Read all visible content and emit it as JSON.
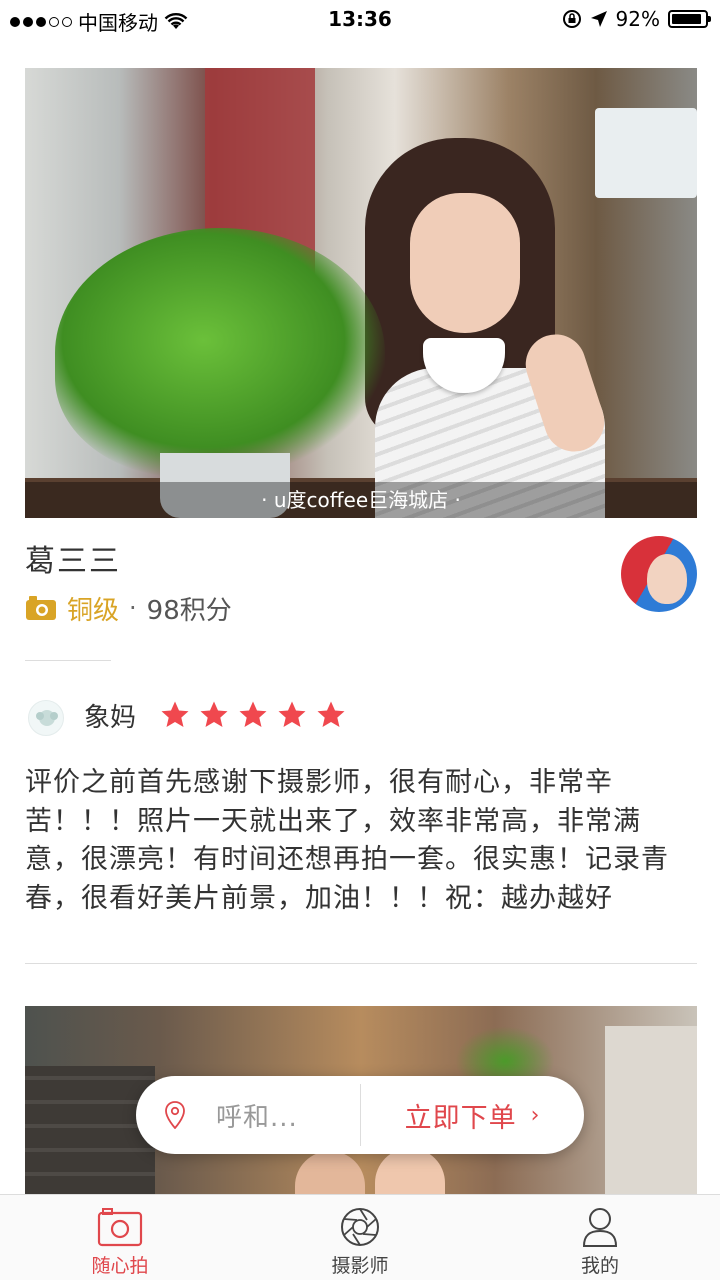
{
  "status_bar": {
    "carrier": "中国移动",
    "time": "13:36",
    "battery": "92%",
    "battery_level": 0.92,
    "signal_bars_filled": 3,
    "signal_bars_total": 5
  },
  "feed": {
    "photo_caption": "· u度coffee巨海城店 ·",
    "photographer": {
      "name": "葛三三",
      "level": "铜级",
      "separator": "·",
      "points": "98积分"
    },
    "review": {
      "reviewer": "象妈",
      "rating": 5,
      "text": "评价之前首先感谢下摄影师，很有耐心，非常辛苦！！！照片一天就出来了，效率非常高，非常满意，很漂亮！有时间还想再拍一套。很实惠！记录青春，很看好美片前景，加油！！！祝：越办越好"
    }
  },
  "order_bar": {
    "location": "呼和...",
    "cta": "立即下单",
    "cta_arrow": "›"
  },
  "tabs": [
    {
      "label": "随心拍",
      "icon": "camera-icon",
      "active": true
    },
    {
      "label": "摄影师",
      "icon": "aperture-icon",
      "active": false
    },
    {
      "label": "我的",
      "icon": "user-icon",
      "active": false
    }
  ],
  "colors": {
    "accent": "#e0474c",
    "gold": "#d9a426",
    "star": "#f0484e"
  }
}
